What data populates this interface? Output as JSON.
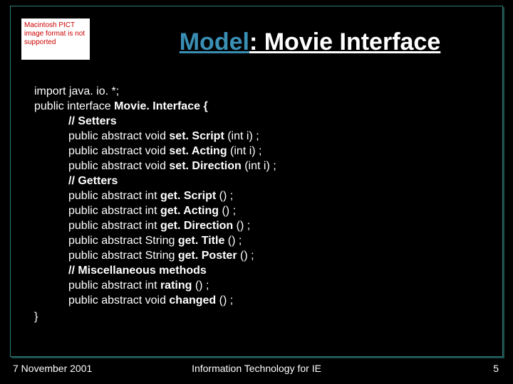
{
  "pict_text": "Macintosh PICT image format is not supported",
  "title": {
    "model": "Model",
    "rest": ": Movie Interface"
  },
  "code": {
    "line1": "import java. io. *;",
    "line2_pre": "public interface ",
    "line2_b": "Movie. Interface {",
    "s_comment": "// Setters",
    "s1_pre": "public abstract void ",
    "s1_b": "set. Script ",
    "s1_post": "(int i) ;",
    "s2_pre": "public abstract void ",
    "s2_b": "set. Acting ",
    "s2_post": "(int i) ;",
    "s3_pre": "public abstract void ",
    "s3_b": "set. Direction ",
    "s3_post": "(int i) ;",
    "g_comment": "// Getters",
    "g1_pre": "public abstract int ",
    "g1_b": "get. Script ",
    "g1_post": "() ;",
    "g2_pre": "public abstract int ",
    "g2_b": "get. Acting ",
    "g2_post": "() ;",
    "g3_pre": "public abstract int ",
    "g3_b": "get. Direction ",
    "g3_post": "() ;",
    "g4_pre": "public abstract String ",
    "g4_b": "get. Title ",
    "g4_post": "() ;",
    "g5_pre": "public abstract String ",
    "g5_b": "get. Poster ",
    "g5_post": "() ;",
    "m_comment": "// Miscellaneous methods",
    "m1_pre": "public abstract int ",
    "m1_b": "rating ",
    "m1_post": "() ;",
    "m2_pre": "public abstract void ",
    "m2_b": "changed ",
    "m2_post": "() ;",
    "close": "}"
  },
  "footer": {
    "date": "7 November 2001",
    "center": "Information Technology for IE",
    "page": "5"
  }
}
